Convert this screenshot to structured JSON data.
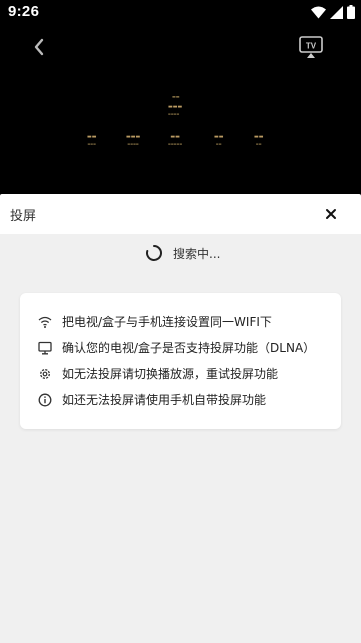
{
  "status_bar": {
    "time": "9:26",
    "icons": [
      "wifi-icon",
      "signal-icon",
      "battery-icon"
    ]
  },
  "video": {
    "back_icon": "chevron-left-icon",
    "tv_icon": "cast-tv-icon",
    "tv_icon_label": "TV"
  },
  "sheet": {
    "title": "投屏",
    "close_icon": "close-icon",
    "searching_text": "搜索中...",
    "tips": [
      {
        "icon": "wifi-icon",
        "text": "把电视/盒子与手机连接设置同一WIFI下"
      },
      {
        "icon": "monitor-icon",
        "text": "确认您的电视/盒子是否支持投屏功能（DLNA）"
      },
      {
        "icon": "gear-icon",
        "text": "如无法投屏请切换播放源，重试投屏功能"
      },
      {
        "icon": "info-icon",
        "text": "如还无法投屏请使用手机自带投屏功能"
      }
    ]
  },
  "colors": {
    "video_bg": "#000000",
    "sheet_header_bg": "#ffffff",
    "sheet_body_bg": "#f0f0f0",
    "credit_gold": "#b99a62"
  }
}
